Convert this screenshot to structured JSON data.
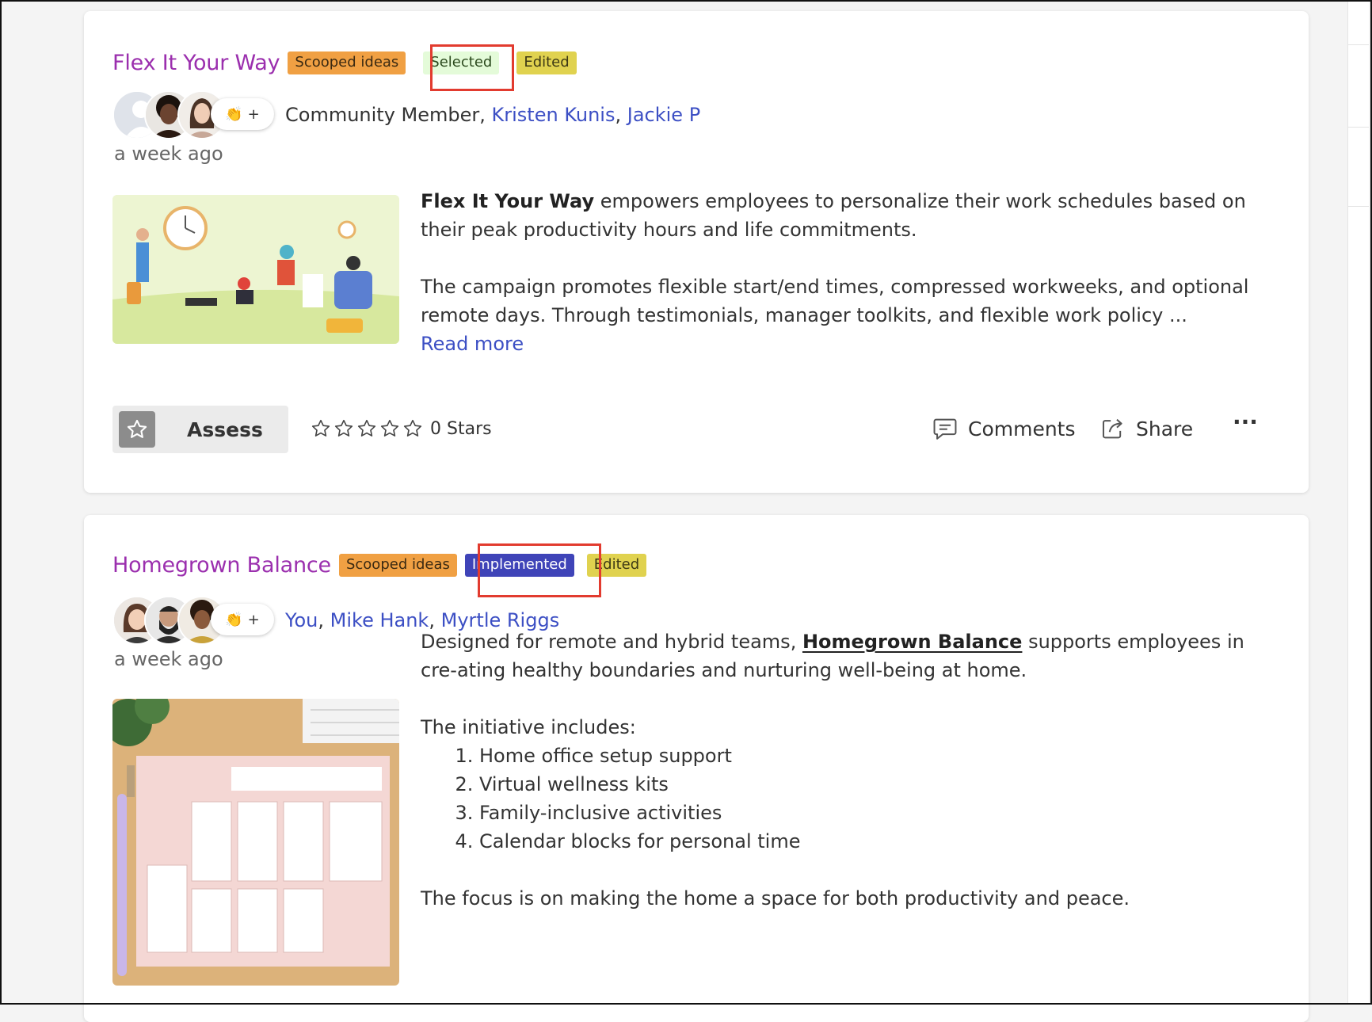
{
  "ideas": [
    {
      "title": "Flex It Your Way",
      "badges": {
        "category": "Scooped ideas",
        "status": "Selected",
        "edited": "Edited"
      },
      "authors": {
        "first": "Community Member",
        "second": "Kristen Kunis",
        "third": "Jackie P",
        "separator": ","
      },
      "reaction_plus": "+",
      "time": "a week ago",
      "body": {
        "lead_bold": "Flex It Your Way",
        "lead_rest": " empowers employees to personalize their work schedules based on their peak productivity hours and life commitments.",
        "para2": "The campaign promotes flexible start/end times, compressed workweeks, and optional remote days. Through testimonials, manager toolkits, and flexible work policy ...",
        "read_more": "Read more"
      },
      "actions": {
        "assess": "Assess",
        "stars": "0 Stars",
        "comments": "Comments",
        "share": "Share",
        "more": "···"
      }
    },
    {
      "title": "Homegrown Balance",
      "badges": {
        "category": "Scooped ideas",
        "status": "Implemented",
        "edited": "Edited"
      },
      "authors": {
        "first": "You",
        "second": "Mike Hank",
        "third": "Myrtle Riggs",
        "separator": ","
      },
      "reaction_plus": "+",
      "time": "a week ago",
      "body": {
        "lead_text": "Designed for remote and hybrid teams, ",
        "lead_underlined": "Homegrown Balance",
        "lead_rest": " supports employees in cre-ating healthy boundaries and nurturing well-being at home.",
        "list_intro": "The initiative includes:",
        "list": [
          "Home office setup support",
          "Virtual wellness kits",
          "Family-inclusive activities",
          "Calendar blocks for personal time"
        ],
        "closing": "The focus is on making the home a space for both productivity and peace."
      }
    }
  ],
  "colors": {
    "title": "#9b2fae",
    "link": "#3c4fc4",
    "highlight": "#e23b2f"
  }
}
